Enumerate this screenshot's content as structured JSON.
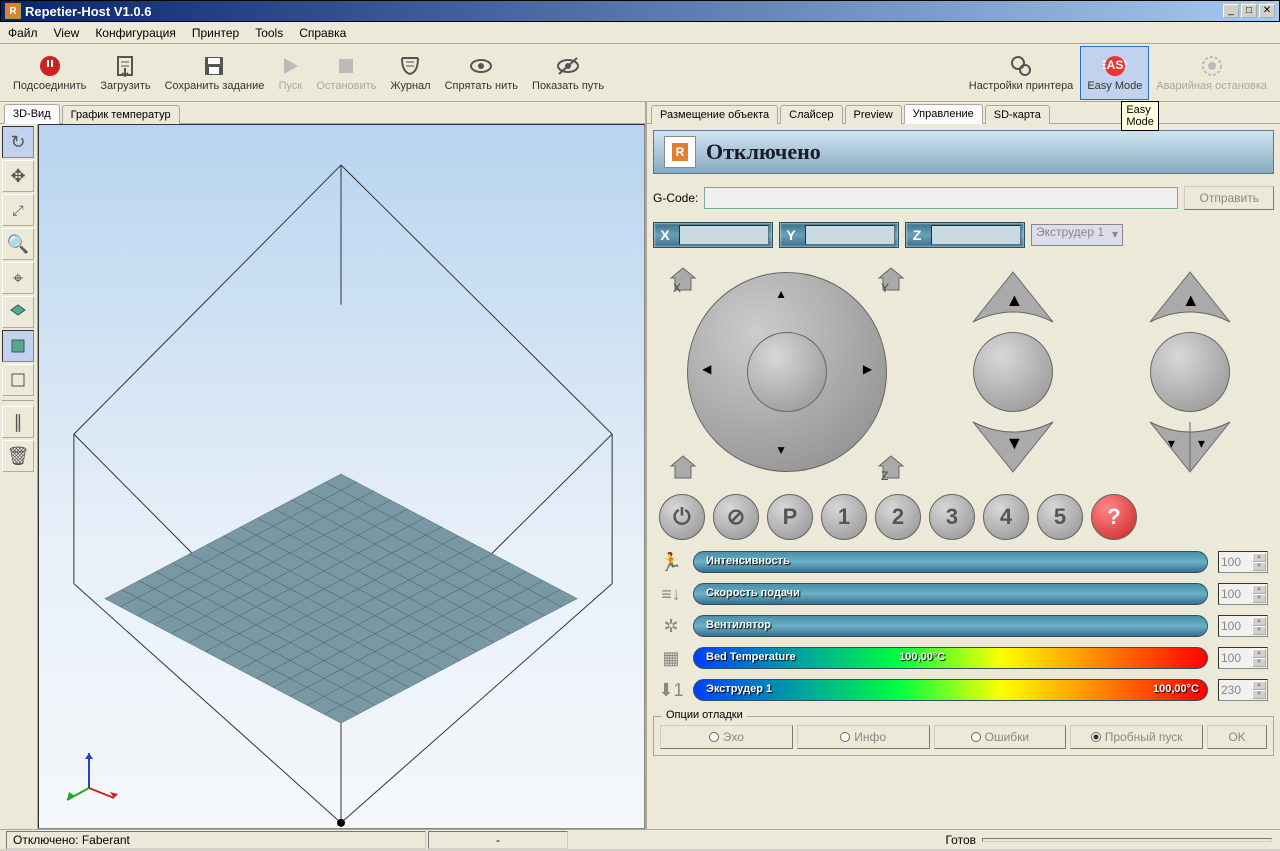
{
  "window": {
    "title": "Repetier-Host V1.0.6"
  },
  "menu": [
    "Файл",
    "View",
    "Конфигурация",
    "Принтер",
    "Tools",
    "Справка"
  ],
  "toolbar": [
    {
      "id": "connect",
      "label": "Подсоединить",
      "disabled": false
    },
    {
      "id": "load",
      "label": "Загрузить",
      "disabled": false
    },
    {
      "id": "save",
      "label": "Сохранить задание",
      "disabled": false
    },
    {
      "id": "play",
      "label": "Пуск",
      "disabled": true
    },
    {
      "id": "stop",
      "label": "Остановить",
      "disabled": true
    },
    {
      "id": "log",
      "label": "Журнал",
      "disabled": false
    },
    {
      "id": "hide",
      "label": "Спрятать нить",
      "disabled": false
    },
    {
      "id": "show",
      "label": "Показать путь",
      "disabled": false
    }
  ],
  "toolbar_right": [
    {
      "id": "psettings",
      "label": "Настройки принтера",
      "disabled": false
    },
    {
      "id": "easy",
      "label": "Easy Mode",
      "disabled": false,
      "highlighted": true
    },
    {
      "id": "estop",
      "label": "Аварийная остановка",
      "disabled": true
    }
  ],
  "tooltip_easy": "Easy Mode",
  "left_tabs": [
    "3D-Вид",
    "График температур"
  ],
  "left_active_tab": 0,
  "right_tabs": [
    "Размещение объекта",
    "Слайсер",
    "Preview",
    "Управление",
    "SD-карта"
  ],
  "right_active_tab": 3,
  "status_header": "Отключено",
  "gcode": {
    "label": "G-Code:",
    "value": "",
    "send": "Отправить"
  },
  "coords": {
    "x_label": "X",
    "y_label": "Y",
    "z_label": "Z",
    "x": "",
    "y": "",
    "z": "",
    "extruder": "Экструдер 1"
  },
  "round_buttons": [
    "⏻",
    "⌀",
    "P",
    "1",
    "2",
    "3",
    "4",
    "5",
    "?"
  ],
  "sliders": [
    {
      "id": "speed",
      "icon": "speed",
      "label": "Интенсивность",
      "value": "100",
      "type": "teal"
    },
    {
      "id": "flow",
      "icon": "flow",
      "label": "Скорость подачи",
      "value": "100",
      "type": "teal"
    },
    {
      "id": "fan",
      "icon": "fan",
      "label": "Вентилятор",
      "value": "100",
      "type": "teal"
    },
    {
      "id": "bed",
      "icon": "bed",
      "label": "Bed Temperature",
      "readout": "100,00°C",
      "readout_pos": "40%",
      "value": "100",
      "type": "rainbow"
    },
    {
      "id": "ext",
      "icon": "ext",
      "label": "Экструдер 1",
      "readout": "100,00°C",
      "readout_pos": "right",
      "value": "230",
      "type": "rainbow"
    }
  ],
  "debug": {
    "title": "Опции отладки",
    "items": [
      "Эхо",
      "Инфо",
      "Ошибки",
      "Пробный пуск"
    ],
    "checked": [
      false,
      false,
      false,
      true
    ],
    "ok": "OK"
  },
  "statusbar": {
    "left": "Отключено: Faberant",
    "mid": "-",
    "right": "Готов"
  }
}
